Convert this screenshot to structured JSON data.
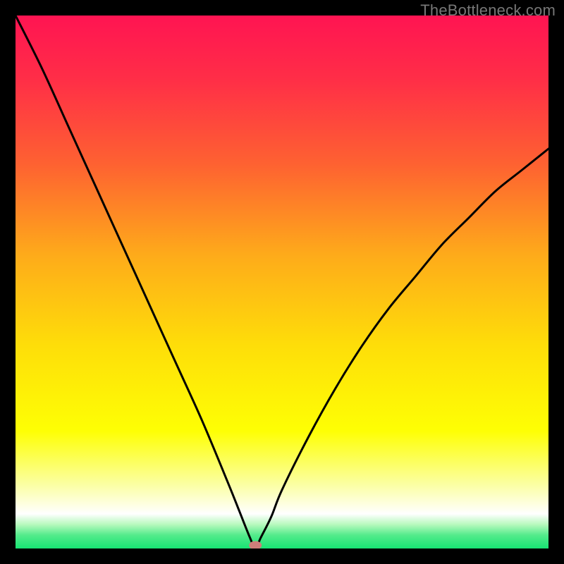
{
  "watermark": "TheBottleneck.com",
  "chart_data": {
    "type": "line",
    "title": "",
    "xlabel": "",
    "ylabel": "",
    "xlim": [
      0,
      100
    ],
    "ylim": [
      0,
      100
    ],
    "grid": false,
    "legend": false,
    "series": [
      {
        "name": "bottleneck-curve",
        "x": [
          0,
          5,
          10,
          15,
          20,
          25,
          30,
          35,
          40,
          42,
          44,
          45,
          46,
          48,
          50,
          55,
          60,
          65,
          70,
          75,
          80,
          85,
          90,
          95,
          100
        ],
        "y": [
          100,
          90,
          79,
          68,
          57,
          46,
          35,
          24,
          12,
          7,
          2,
          0,
          2,
          6,
          11,
          21,
          30,
          38,
          45,
          51,
          57,
          62,
          67,
          71,
          75
        ]
      }
    ],
    "gradient_stops": [
      {
        "pos": 0.0,
        "color": "#ff1452"
      },
      {
        "pos": 0.12,
        "color": "#ff2e47"
      },
      {
        "pos": 0.28,
        "color": "#fe6231"
      },
      {
        "pos": 0.45,
        "color": "#feab1a"
      },
      {
        "pos": 0.62,
        "color": "#fede09"
      },
      {
        "pos": 0.78,
        "color": "#feff04"
      },
      {
        "pos": 0.88,
        "color": "#fbffa3"
      },
      {
        "pos": 0.935,
        "color": "#ffffff"
      },
      {
        "pos": 0.955,
        "color": "#b7f9bd"
      },
      {
        "pos": 0.975,
        "color": "#53eb8b"
      },
      {
        "pos": 1.0,
        "color": "#17e473"
      }
    ],
    "marker": {
      "x": 45,
      "y": 0.6,
      "rx": 9,
      "ry": 6,
      "color": "#cd7e7a"
    }
  }
}
